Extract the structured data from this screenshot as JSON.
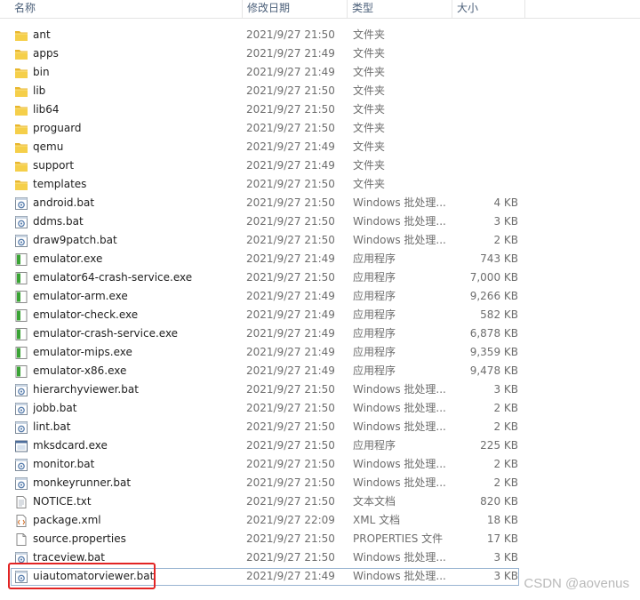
{
  "columns": {
    "name": "名称",
    "date": "修改日期",
    "type": "类型",
    "size": "大小"
  },
  "files": [
    {
      "icon": "folder-icon",
      "name": "ant",
      "date": "2021/9/27 21:50",
      "type": "文件夹",
      "size": ""
    },
    {
      "icon": "folder-icon",
      "name": "apps",
      "date": "2021/9/27 21:49",
      "type": "文件夹",
      "size": ""
    },
    {
      "icon": "folder-icon",
      "name": "bin",
      "date": "2021/9/27 21:49",
      "type": "文件夹",
      "size": ""
    },
    {
      "icon": "folder-icon",
      "name": "lib",
      "date": "2021/9/27 21:50",
      "type": "文件夹",
      "size": ""
    },
    {
      "icon": "folder-icon",
      "name": "lib64",
      "date": "2021/9/27 21:50",
      "type": "文件夹",
      "size": ""
    },
    {
      "icon": "folder-icon",
      "name": "proguard",
      "date": "2021/9/27 21:50",
      "type": "文件夹",
      "size": ""
    },
    {
      "icon": "folder-icon",
      "name": "qemu",
      "date": "2021/9/27 21:49",
      "type": "文件夹",
      "size": ""
    },
    {
      "icon": "folder-icon",
      "name": "support",
      "date": "2021/9/27 21:49",
      "type": "文件夹",
      "size": ""
    },
    {
      "icon": "folder-icon",
      "name": "templates",
      "date": "2021/9/27 21:50",
      "type": "文件夹",
      "size": ""
    },
    {
      "icon": "batch-file-icon",
      "name": "android.bat",
      "date": "2021/9/27 21:50",
      "type": "Windows 批处理...",
      "size": "4 KB"
    },
    {
      "icon": "batch-file-icon",
      "name": "ddms.bat",
      "date": "2021/9/27 21:50",
      "type": "Windows 批处理...",
      "size": "3 KB"
    },
    {
      "icon": "batch-file-icon",
      "name": "draw9patch.bat",
      "date": "2021/9/27 21:50",
      "type": "Windows 批处理...",
      "size": "2 KB"
    },
    {
      "icon": "emulator-exe-icon",
      "name": "emulator.exe",
      "date": "2021/9/27 21:49",
      "type": "应用程序",
      "size": "743 KB"
    },
    {
      "icon": "emulator-exe-icon",
      "name": "emulator64-crash-service.exe",
      "date": "2021/9/27 21:50",
      "type": "应用程序",
      "size": "7,000 KB"
    },
    {
      "icon": "emulator-exe-icon",
      "name": "emulator-arm.exe",
      "date": "2021/9/27 21:49",
      "type": "应用程序",
      "size": "9,266 KB"
    },
    {
      "icon": "emulator-exe-icon",
      "name": "emulator-check.exe",
      "date": "2021/9/27 21:49",
      "type": "应用程序",
      "size": "582 KB"
    },
    {
      "icon": "emulator-exe-icon",
      "name": "emulator-crash-service.exe",
      "date": "2021/9/27 21:49",
      "type": "应用程序",
      "size": "6,878 KB"
    },
    {
      "icon": "emulator-exe-icon",
      "name": "emulator-mips.exe",
      "date": "2021/9/27 21:49",
      "type": "应用程序",
      "size": "9,359 KB"
    },
    {
      "icon": "emulator-exe-icon",
      "name": "emulator-x86.exe",
      "date": "2021/9/27 21:49",
      "type": "应用程序",
      "size": "9,478 KB"
    },
    {
      "icon": "batch-file-icon",
      "name": "hierarchyviewer.bat",
      "date": "2021/9/27 21:50",
      "type": "Windows 批处理...",
      "size": "3 KB"
    },
    {
      "icon": "batch-file-icon",
      "name": "jobb.bat",
      "date": "2021/9/27 21:50",
      "type": "Windows 批处理...",
      "size": "2 KB"
    },
    {
      "icon": "batch-file-icon",
      "name": "lint.bat",
      "date": "2021/9/27 21:50",
      "type": "Windows 批处理...",
      "size": "2 KB"
    },
    {
      "icon": "generic-exe-icon",
      "name": "mksdcard.exe",
      "date": "2021/9/27 21:50",
      "type": "应用程序",
      "size": "225 KB"
    },
    {
      "icon": "batch-file-icon",
      "name": "monitor.bat",
      "date": "2021/9/27 21:50",
      "type": "Windows 批处理...",
      "size": "2 KB"
    },
    {
      "icon": "batch-file-icon",
      "name": "monkeyrunner.bat",
      "date": "2021/9/27 21:50",
      "type": "Windows 批处理...",
      "size": "2 KB"
    },
    {
      "icon": "text-file-icon",
      "name": "NOTICE.txt",
      "date": "2021/9/27 21:50",
      "type": "文本文档",
      "size": "820 KB"
    },
    {
      "icon": "xml-file-icon",
      "name": "package.xml",
      "date": "2021/9/27 22:09",
      "type": "XML 文档",
      "size": "18 KB"
    },
    {
      "icon": "generic-file-icon",
      "name": "source.properties",
      "date": "2021/9/27 21:50",
      "type": "PROPERTIES 文件",
      "size": "17 KB"
    },
    {
      "icon": "batch-file-icon",
      "name": "traceview.bat",
      "date": "2021/9/27 21:50",
      "type": "Windows 批处理...",
      "size": "3 KB"
    },
    {
      "icon": "batch-file-icon",
      "name": "uiautomatorviewer.bat",
      "date": "2021/9/27 21:49",
      "type": "Windows 批处理...",
      "size": "3 KB",
      "selected": true
    }
  ],
  "watermark": "CSDN @aovenus",
  "colors": {
    "folder": "#e8b62c",
    "emulator_green": "#3aa335",
    "highlight_border": "#e22424",
    "selection_border": "#99b4d1"
  }
}
